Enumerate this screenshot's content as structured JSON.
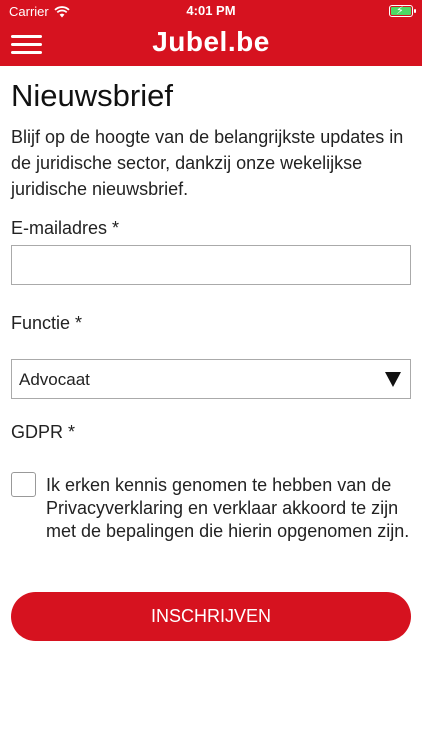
{
  "status_bar": {
    "carrier": "Carrier",
    "time": "4:01 PM",
    "wifi_icon": "wifi-icon",
    "battery_icon": "battery-charging-icon"
  },
  "header": {
    "menu_icon": "hamburger-menu-icon",
    "brand": "Jubel.be",
    "background_color": "#d6121f"
  },
  "page": {
    "title": "Nieuwsbrief",
    "intro": "Blijf op de hoogte van de belangrijkste updates in de juridische sector, dankzij onze wekelijkse juridische nieuwsbrief."
  },
  "form": {
    "email": {
      "label": "E-mailadres *",
      "value": "",
      "placeholder": ""
    },
    "functie": {
      "label": "Functie *",
      "selected": "Advocaat"
    },
    "gdpr": {
      "label": "GDPR *",
      "checked": false,
      "text": "Ik erken kennis genomen te hebben van de Privacyverklaring en verklaar akkoord te zijn met de bepalingen die hierin opgenomen zijn."
    },
    "submit_label": "INSCHRIJVEN"
  }
}
